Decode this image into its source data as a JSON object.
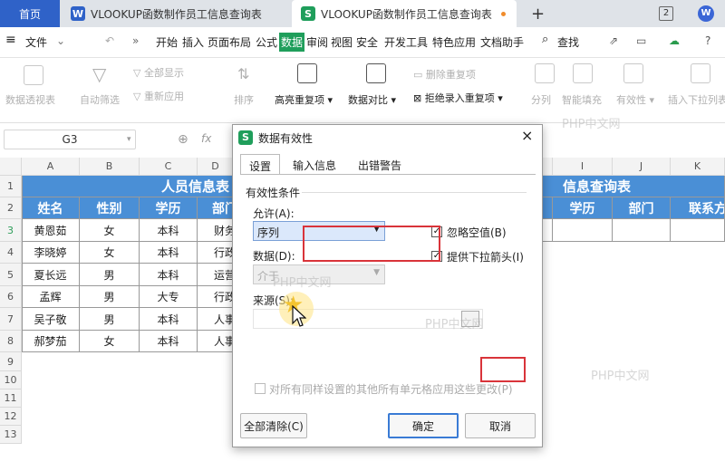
{
  "tabs": {
    "home": "首页",
    "tab1": "VLOOKUP函数制作员工信息查询表",
    "tab2": "VLOOKUP函数制作员工信息查询表",
    "add": "+",
    "count": "2",
    "doc_ico": "W",
    "sheet_ico": "S"
  },
  "menubar": {
    "file": "文件",
    "items": [
      "开始",
      "插入",
      "页面布局",
      "公式",
      "数据",
      "审阅",
      "视图",
      "安全",
      "开发工具",
      "特色应用",
      "文档助手"
    ],
    "search": "查找"
  },
  "ribbon": {
    "pivot": "数据透视表",
    "autofilter": "自动筛选",
    "show_all": "全部显示",
    "reapply": "重新应用",
    "sort": "排序",
    "highlight_dup": "高亮重复项",
    "compare": "数据对比",
    "remove_dup": "删除重复项",
    "reject_dup": "拒绝录入重复项",
    "split": "分列",
    "smart_fill": "智能填充",
    "validity": "有效性",
    "insert_dropdown": "插入下拉列表"
  },
  "formula_bar": {
    "name_box": "G3",
    "fx": "fx"
  },
  "sheet": {
    "columns": [
      "A",
      "B",
      "C",
      "D",
      "E",
      "F",
      "G",
      "H",
      "I",
      "J",
      "K"
    ],
    "rows": [
      "1",
      "2",
      "3",
      "4",
      "5",
      "6",
      "7",
      "8",
      "9",
      "10",
      "11",
      "12",
      "13"
    ],
    "left_title": "人员信息表",
    "right_title": "信息查询表",
    "headers": [
      "姓名",
      "性别",
      "学历",
      "部门"
    ],
    "right_headers": [
      "学历",
      "部门",
      "联系方"
    ],
    "data": [
      [
        "黄恩茹",
        "女",
        "本科",
        "财务"
      ],
      [
        "李晓婷",
        "女",
        "本科",
        "行政"
      ],
      [
        "夏长远",
        "男",
        "本科",
        "运营"
      ],
      [
        "孟辉",
        "男",
        "大专",
        "行政"
      ],
      [
        "吴子敬",
        "男",
        "本科",
        "人事"
      ],
      [
        "郝梦茄",
        "女",
        "本科",
        "人事"
      ]
    ]
  },
  "dialog": {
    "title": "数据有效性",
    "close": "×",
    "tabs": [
      "设置",
      "输入信息",
      "出错警告"
    ],
    "section": "有效性条件",
    "allow_label": "允许(A):",
    "allow_value": "序列",
    "data_label": "数据(D):",
    "data_value": "介于",
    "ignore_blank": "忽略空值(B)",
    "dropdown_arrow": "提供下拉箭头(I)",
    "source_label": "来源(S):",
    "source_value": "",
    "apply_all": "对所有同样设置的其他所有单元格应用这些更改(P)",
    "clear_all": "全部清除(C)",
    "ok": "确定",
    "cancel": "取消"
  },
  "watermark": "PHP中文网",
  "colors": {
    "header_blue": "#4a8fd6",
    "wps_green": "#1f9e5b",
    "home_tab": "#2f62c8",
    "highlight_red": "#d9343a"
  }
}
